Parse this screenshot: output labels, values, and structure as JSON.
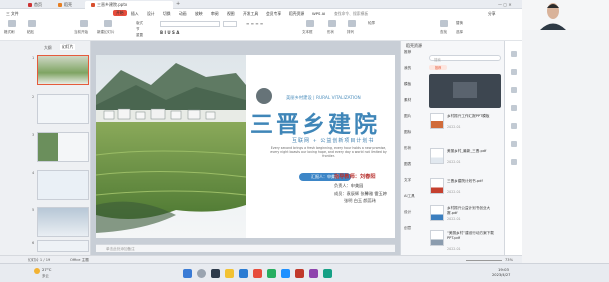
{
  "titlebar": {
    "tabs": [
      {
        "label": "首页",
        "active": false
      },
      {
        "label": "稻壳",
        "active": false
      },
      {
        "label": "三晋乡建院.pptx",
        "active": true
      }
    ],
    "new_tab": "+"
  },
  "ribbon_menu": {
    "file": "三 文件",
    "items": [
      "开始",
      "插入",
      "设计",
      "切换",
      "动画",
      "放映",
      "审阅",
      "视图",
      "开发工具",
      "会员专享",
      "稻壳资源",
      "WPS AI"
    ],
    "search": "查找命令、搜索模板",
    "share": "分享"
  },
  "toolbar": {
    "groups": [
      "格式刷",
      "粘贴",
      "当前开始",
      "新建幻灯片",
      "版式",
      "节",
      "重置",
      "文本框",
      "形状",
      "排列",
      "轮廓",
      "查找",
      "替换",
      "选择"
    ]
  },
  "sidebar": {
    "tabs": [
      "大纲",
      "幻灯片"
    ],
    "slide_numbers": [
      "1",
      "2",
      "3",
      "4",
      "5",
      "6"
    ]
  },
  "slide": {
    "subtitle_cn": "美丽乡村建设",
    "subtitle_en": "RURAL VITALIZATION",
    "title": "三晋乡建院",
    "tagline": "互联网 + 公益创新项目计划书",
    "english_body": "Every second brings a fresh beginning, every hour holds a new promise, every night boasts our loving hope, and every day a world not limited by frontier.",
    "badge": "汇报人：申美园",
    "advisor": "指导教师：刘春阳",
    "leader": "负责人：申美园",
    "members_line1": "成员：袁辰辉 张馨雅 雷玉婷",
    "members_line2": "张明 白玉 颜蕊玮"
  },
  "notes_placeholder": "单击此处添加备注",
  "panel": {
    "header": "稻壳资源",
    "search_placeholder": "搜索",
    "chip": "推荐",
    "categories": [
      "推荐",
      "我的",
      "模板",
      "素材",
      "图片",
      "图标",
      "形状",
      "图表",
      "文字",
      "AI工具",
      "设计",
      "创意"
    ],
    "results": [
      {
        "title": "乡村振兴工作汇报PPT模板",
        "date": "2022.01",
        "tag": "模板"
      },
      {
        "title": "美丽乡村_最新_三晋.pdf",
        "date": "2022.01",
        "tag": "模板"
      },
      {
        "title": "三晋乡建院计划书.pdf",
        "date": "2022.01",
        "tag": "模板"
      },
      {
        "title": "乡村振兴公益计划书创业大赛.pdf",
        "date": "2022.01",
        "tag": "模板"
      },
      {
        "title": "“美丽乡村”建设行动方案下载PPT.pdf",
        "date": "2022.01",
        "tag": "模板"
      }
    ]
  },
  "statusbar": {
    "slide_indicator": "幻灯片 1 / 19",
    "theme": "Office 主题",
    "zoom": "73%"
  },
  "taskbar": {
    "weather": "27°C",
    "weather_desc": "多云",
    "time": "19:03",
    "date": "2023/4/27"
  },
  "colors": {
    "accent": "#e55b3c",
    "title_blue": "#3f86b8",
    "subtitle_blue": "#4e8fbd",
    "badge_blue": "#3d86c7",
    "advisor_red": "#b8322f"
  }
}
